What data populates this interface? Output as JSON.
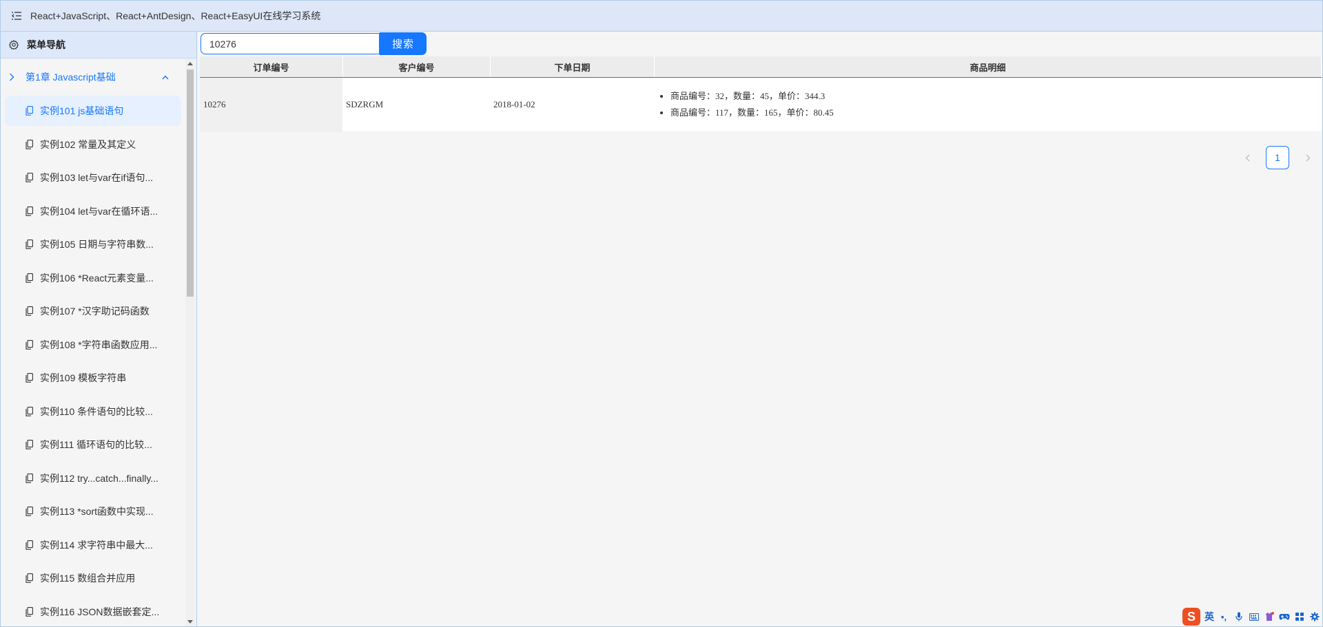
{
  "window": {
    "title": "React+JavaScript、React+AntDesign、React+EasyUI在线学习系统",
    "menu_toggle_icon": "menu-fold-icon"
  },
  "sidebar": {
    "header_label": "菜单导航",
    "header_icon": "gear-icon",
    "chapter": {
      "label": "第1章 Javascript基础",
      "expanded": true
    },
    "items": [
      {
        "label": "实例101 js基础语句",
        "active": true
      },
      {
        "label": "实例102 常量及其定义"
      },
      {
        "label": "实例103 let与var在if语句..."
      },
      {
        "label": "实例104 let与var在循环语..."
      },
      {
        "label": "实例105 日期与字符串数..."
      },
      {
        "label": "实例106 *React元素变量..."
      },
      {
        "label": "实例107 *汉字助记码函数"
      },
      {
        "label": "实例108 *字符串函数应用..."
      },
      {
        "label": "实例109 模板字符串"
      },
      {
        "label": "实例110 条件语句的比较..."
      },
      {
        "label": "实例111 循环语句的比较..."
      },
      {
        "label": "实例112 try...catch...finally..."
      },
      {
        "label": "实例113 *sort函数中实现..."
      },
      {
        "label": "实例114 求字符串中最大..."
      },
      {
        "label": "实例115 数组合并应用"
      },
      {
        "label": "实例116 JSON数据嵌套定..."
      }
    ]
  },
  "search": {
    "value": "10276",
    "button_label": "搜索"
  },
  "table": {
    "columns": [
      "订单编号",
      "客户编号",
      "下单日期",
      "商品明细"
    ],
    "rows": [
      {
        "order_id": "10276",
        "customer_id": "SDZRGM",
        "order_date": "2018-01-02",
        "details": [
          "商品编号：32，数量：45，单价：344.3",
          "商品编号：117，数量：165，单价：80.45"
        ]
      }
    ]
  },
  "pagination": {
    "current_page": "1"
  },
  "ime": {
    "logo": "S",
    "mode": "英",
    "punct": "•,",
    "colors": {
      "logo_bg": "#ee4f22",
      "icons": "#1a66cc"
    }
  },
  "colors": {
    "accent": "#1677ff",
    "topbar_bg": "#dde7f8",
    "sidebar_header_bg": "#dde9fb",
    "active_item_bg": "#e6f0ff"
  }
}
